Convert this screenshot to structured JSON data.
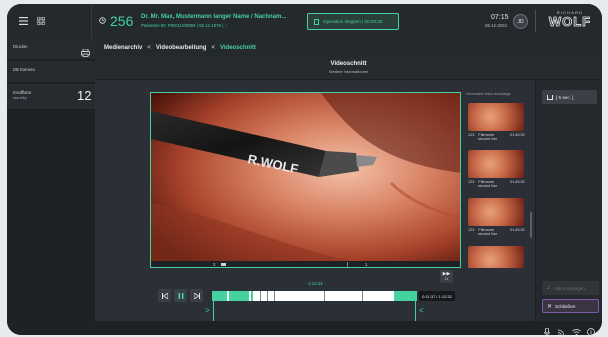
{
  "header": {
    "counter": "256",
    "patient_name": "Dr. Mr. Max, Mustermann langer Name / Nachnam...",
    "patient_info": "Patienten-ID: PID01U00999 | 06.12.1976 | ♂",
    "operation_button": "Operation stoppen | 00:00:32",
    "time": "07:15",
    "date": "06.12.2022",
    "user_initials": "JD",
    "brand_top": "RICHARD",
    "brand_main": "WOLF"
  },
  "sidebar": {
    "items": [
      {
        "label": "Drucker",
        "value": ""
      },
      {
        "label": "DB Kamera",
        "value": ""
      },
      {
        "label": "Insufflator",
        "sub": "standby",
        "value": "12"
      }
    ]
  },
  "breadcrumb": {
    "items": [
      "Medienarchiv",
      "Videobearbeitung",
      "Videoschnitt"
    ],
    "separator": "<"
  },
  "page": {
    "title": "Videoschnitt",
    "subtitle": "Weitere Informationen"
  },
  "video": {
    "scope_text": "R.WOLF",
    "marker_left": "2",
    "marker_right": "1",
    "timecode": "1:12:31",
    "current_time": "0:11:37 / 1:12:32",
    "speed_label": "1x"
  },
  "recordings": {
    "header": "Generated video recordings",
    "items": [
      {
        "index": "123",
        "name": "Filename",
        "line2": "second line",
        "duration": "01:45:32"
      },
      {
        "index": "123",
        "name": "Filename",
        "line2": "second line",
        "duration": "01:45:32"
      },
      {
        "index": "123",
        "name": "Filename",
        "line2": "second line",
        "duration": "01:45:32"
      },
      {
        "index": "",
        "name": "",
        "line2": "",
        "duration": ""
      }
    ]
  },
  "right_panel": {
    "interval_button": "[ 5 sec. ]",
    "create_button": "Video erzeugen",
    "close_button": "Schließen"
  },
  "colors": {
    "accent": "#45d1a0",
    "selection": "#7f5aa8"
  }
}
